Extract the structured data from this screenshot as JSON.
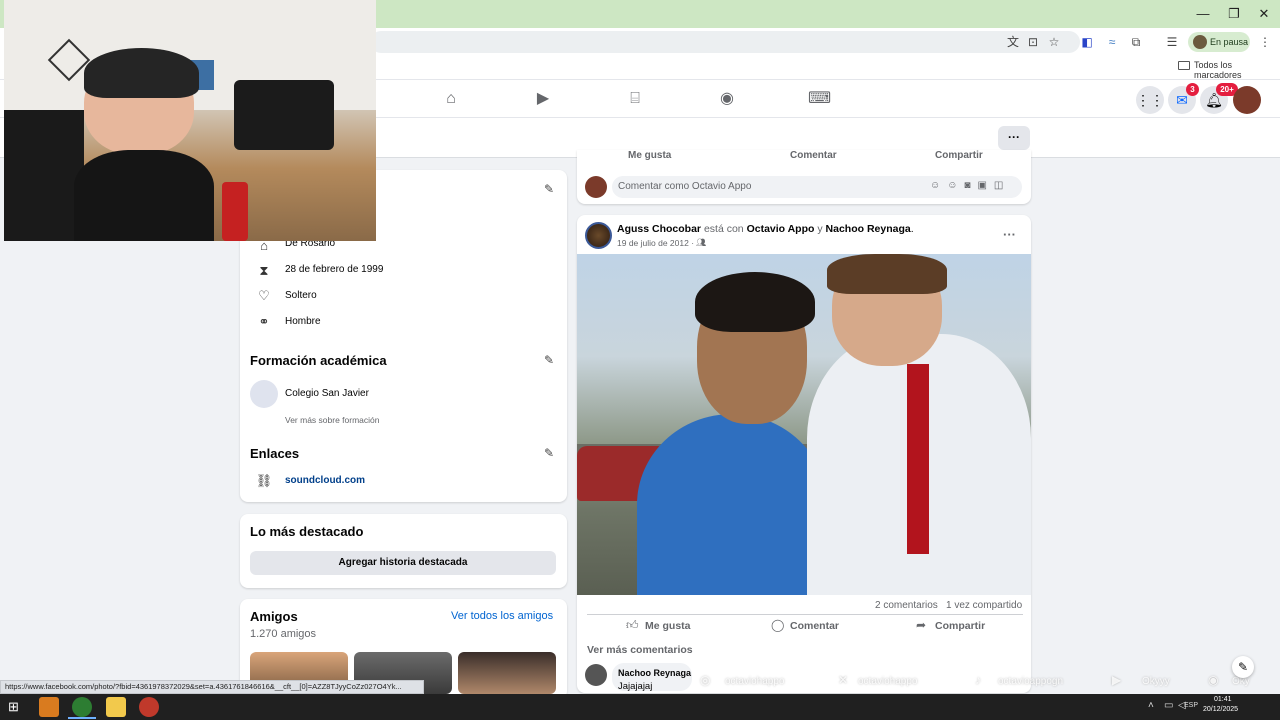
{
  "browser": {
    "profile_label": "En pausa",
    "bookmarks_all": "Todos los marcadores",
    "status_url": "https://www.facebook.com/photo/?fbid=4361978372029&set=a.4361761846616&__cft__[0]=AZZ8TJyyCoZz027O4Yk..."
  },
  "fbnav": {
    "messenger_badge": "3",
    "notif_badge": "20+",
    "more_label": "···"
  },
  "intro": {
    "from": "De Rosario",
    "birthday": "28 de febrero de 1999",
    "relationship": "Soltero",
    "gender": "Hombre",
    "education_title": "Formación académica",
    "school": "Colegio San Javier",
    "education_more": "Ver más sobre formación",
    "links_title": "Enlaces",
    "link": "soundcloud.com"
  },
  "featured": {
    "title": "Lo más destacado",
    "add_button": "Agregar historia destacada"
  },
  "friends": {
    "title": "Amigos",
    "count": "1.270 amigos",
    "see_all": "Ver todos los amigos"
  },
  "top_post": {
    "like": "Me gusta",
    "comment": "Comentar",
    "share": "Compartir",
    "comment_placeholder": "Comentar como Octavio Appo"
  },
  "post": {
    "author": "Aguss Chocobar",
    "with_text": "está con",
    "tag1": "Octavio Appo",
    "and_text": "y",
    "tag2": "Nachoo Reynaga",
    "period": ".",
    "date": "19 de julio de 2012 ·",
    "comments_count": "2 comentarios",
    "shares_count": "1 vez compartido",
    "like": "Me gusta",
    "comment": "Comentar",
    "share": "Compartir",
    "more_comments": "Ver más comentarios",
    "commenter": "Nachoo Reynaga",
    "comment_text": "Jajajajaj"
  },
  "overlay": {
    "instagram": "octaviohappo",
    "x": "octaviohappo",
    "tiktok": "octavioappogn",
    "youtube": "Okyyy",
    "spotify": "Oky"
  },
  "taskbar": {
    "lang": "ESP",
    "time": "01:41",
    "date": "20/12/2025"
  },
  "colors": {
    "fb_blue": "#0866ff",
    "badge_red": "#e41e3f",
    "titlebar": "#cde7c3"
  }
}
